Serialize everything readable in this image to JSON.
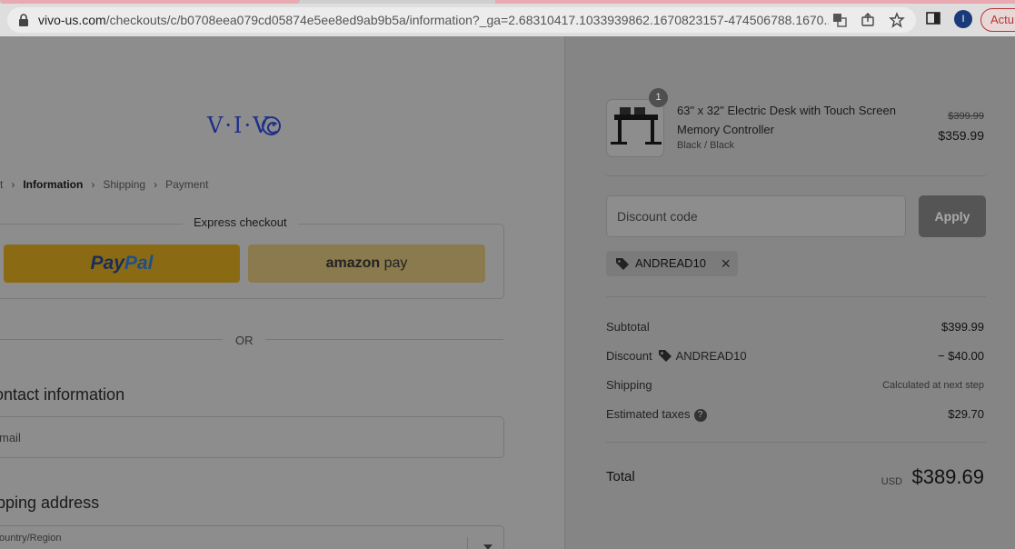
{
  "browser": {
    "url_host": "vivo-us.com",
    "url_path": "/checkouts/c/b0708eea079cd05874e5ee8ed9ab9b5a/information?_ga=2.68310417.1033939862.1670823157-474506788.1670...",
    "avatar_letter": "I",
    "pill_label": "Actu"
  },
  "logo": {
    "text": "V·I·V·"
  },
  "breadcrumbs": {
    "cart": "t",
    "information": "Information",
    "shipping": "Shipping",
    "payment": "Payment"
  },
  "express": {
    "label": "Express checkout",
    "paypal_pay": "Pay",
    "paypal_pal": "Pal",
    "amazon_a": "amazon",
    "amazon_pay": " pay"
  },
  "divider_or": "OR",
  "contact": {
    "heading": "ontact information",
    "email_placeholder": "mail"
  },
  "shipping_address": {
    "heading": "ipping address",
    "country_label": "ountry/Region"
  },
  "cart": {
    "quantity": "1",
    "product_name": "63\" x 32\" Electric Desk with Touch Screen Memory Controller",
    "variant": "Black / Black",
    "original_price": "$399.99",
    "price": "$359.99"
  },
  "discount": {
    "placeholder": "Discount code",
    "apply_label": "Apply",
    "applied_code": "ANDREAD10",
    "remove_icon": "×"
  },
  "summary": {
    "subtotal_label": "Subtotal",
    "subtotal_value": "$399.99",
    "discount_label": "Discount",
    "discount_code": "ANDREAD10",
    "discount_value": "− $40.00",
    "shipping_label": "Shipping",
    "shipping_value": "Calculated at next step",
    "taxes_label": "Estimated taxes",
    "taxes_help": "?",
    "taxes_value": "$29.70",
    "total_label": "Total",
    "total_currency": "USD",
    "total_value": "$389.69"
  },
  "colors": {
    "brand": "#1d2f8a",
    "overlay_bg": "#8d8d8d",
    "apply_bg": "#555555"
  }
}
